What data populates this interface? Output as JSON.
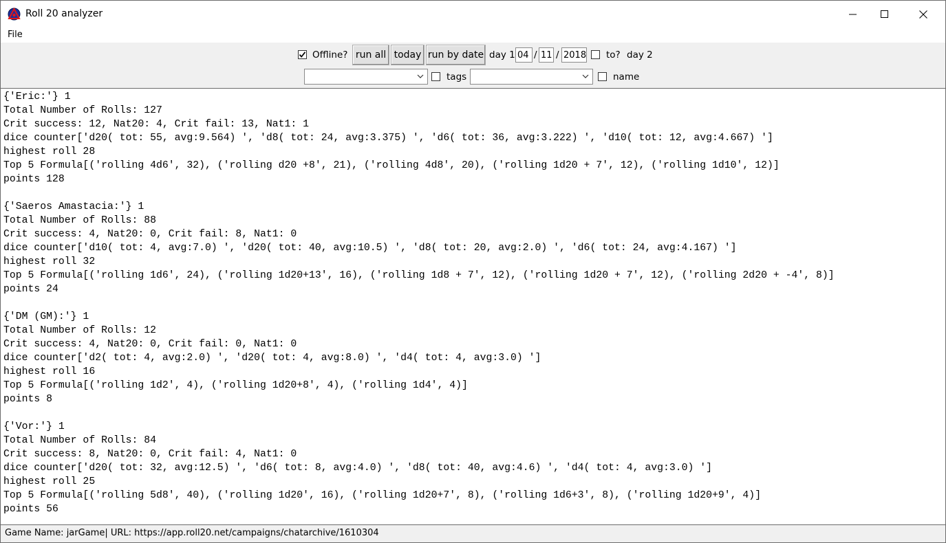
{
  "window": {
    "title": "Roll 20 analyzer",
    "controls": [
      "minimize-icon",
      "maximize-icon",
      "close-icon"
    ]
  },
  "menu": {
    "file": "File"
  },
  "toolbar": {
    "offline_label": "Offline?",
    "offline_checked": true,
    "run_all": "run all",
    "today": "today",
    "run_by_date": "run by date",
    "day1_label": "day 1",
    "day1_month": "04",
    "sep1": "/",
    "day1_day": "11",
    "sep2": "/",
    "day1_year": "2018",
    "to_label": "to?",
    "to_checked": false,
    "day2_label": "day 2",
    "combo1_value": "",
    "tags_label": "tags",
    "tags_checked": false,
    "combo2_value": "",
    "name_label": "name",
    "name_checked": false
  },
  "output": {
    "lines": [
      "{'Eric:'} 1",
      "Total Number of Rolls: 127",
      "Crit success: 12, Nat20: 4, Crit fail: 13, Nat1: 1",
      "dice counter['d20( tot: 55, avg:9.564) ', 'd8( tot: 24, avg:3.375) ', 'd6( tot: 36, avg:3.222) ', 'd10( tot: 12, avg:4.667) ']",
      "highest roll 28",
      "Top 5 Formula[('rolling 4d6', 32), ('rolling d20 +8', 21), ('rolling 4d8', 20), ('rolling 1d20 + 7', 12), ('rolling 1d10', 12)]",
      "points 128",
      "",
      "{'Saeros Amastacia:'} 1",
      "Total Number of Rolls: 88",
      "Crit success: 4, Nat20: 0, Crit fail: 8, Nat1: 0",
      "dice counter['d10( tot: 4, avg:7.0) ', 'd20( tot: 40, avg:10.5) ', 'd8( tot: 20, avg:2.0) ', 'd6( tot: 24, avg:4.167) ']",
      "highest roll 32",
      "Top 5 Formula[('rolling 1d6', 24), ('rolling 1d20+13', 16), ('rolling 1d8 + 7', 12), ('rolling 1d20 + 7', 12), ('rolling 2d20 + -4', 8)]",
      "points 24",
      "",
      "{'DM (GM):'} 1",
      "Total Number of Rolls: 12",
      "Crit success: 4, Nat20: 0, Crit fail: 0, Nat1: 0",
      "dice counter['d2( tot: 4, avg:2.0) ', 'd20( tot: 4, avg:8.0) ', 'd4( tot: 4, avg:3.0) ']",
      "highest roll 16",
      "Top 5 Formula[('rolling 1d2', 4), ('rolling 1d20+8', 4), ('rolling 1d4', 4)]",
      "points 8",
      "",
      "{'Vor:'} 1",
      "Total Number of Rolls: 84",
      "Crit success: 8, Nat20: 0, Crit fail: 4, Nat1: 0",
      "dice counter['d20( tot: 32, avg:12.5) ', 'd6( tot: 8, avg:4.0) ', 'd8( tot: 40, avg:4.6) ', 'd4( tot: 4, avg:3.0) ']",
      "highest roll 25",
      "Top 5 Formula[('rolling 5d8', 40), ('rolling 1d20', 16), ('rolling 1d20+7', 8), ('rolling 1d6+3', 8), ('rolling 1d20+9', 4)]",
      "points 56"
    ]
  },
  "status": {
    "text": "Game Name: jarGame| URL: https://app.roll20.net/campaigns/chatarchive/1610304"
  }
}
